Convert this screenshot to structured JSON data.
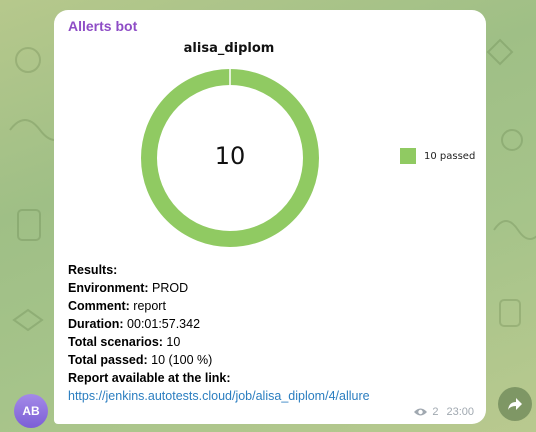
{
  "chat": {
    "sender": "Allerts bot",
    "avatar_initials": "AB",
    "time": "23:00",
    "views": "2",
    "theme": {
      "accent": "#8e4dc6",
      "link": "#2b7ec0",
      "avatar": "#8b6fe0"
    }
  },
  "chart_data": {
    "type": "pie",
    "title": "alisa_diplom",
    "center_label": "10",
    "categories": [
      "10 passed"
    ],
    "values": [
      10
    ],
    "colors": [
      "#90ca62"
    ],
    "legend_position": "right"
  },
  "report": {
    "results_label": "Results:",
    "environment_label": "Environment:",
    "environment_value": " PROD",
    "comment_label": "Comment:",
    "comment_value": " report",
    "duration_label": "Duration:",
    "duration_value": " 00:01:57.342",
    "scenarios_label": "Total scenarios:",
    "scenarios_value": " 10",
    "passed_label": "Total passed:",
    "passed_value": " 10 (100 %)",
    "link_label": "Report available at the link:",
    "link_url": "https://jenkins.autotests.cloud/job/alisa_diplom/4/allure"
  },
  "icons": {
    "views": "eye-icon",
    "share": "share-arrow-icon"
  }
}
